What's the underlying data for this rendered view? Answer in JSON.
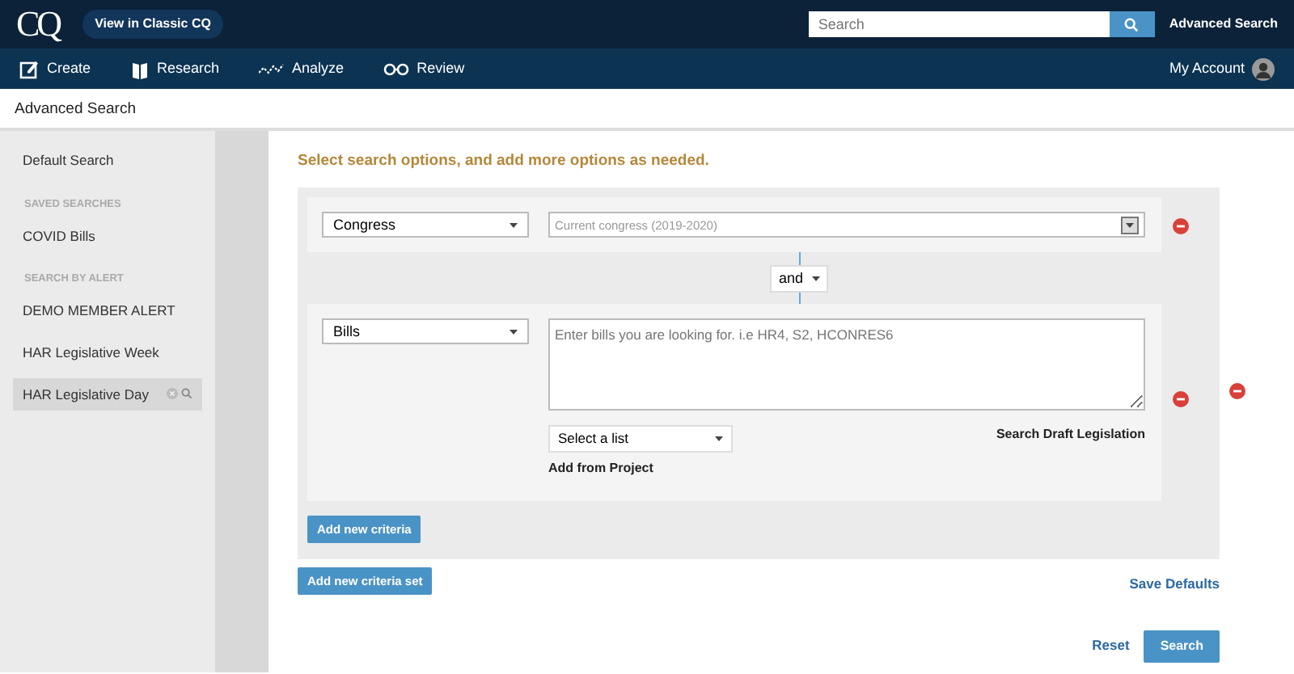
{
  "header": {
    "logo": "CQ",
    "classic_button": "View in Classic CQ",
    "search": {
      "placeholder": "Search"
    },
    "advanced_link": "Advanced Search"
  },
  "nav": {
    "items": [
      {
        "label": "Create"
      },
      {
        "label": "Research"
      },
      {
        "label": "Analyze"
      },
      {
        "label": "Review"
      }
    ],
    "account": "My Account"
  },
  "page_title": "Advanced Search",
  "sidebar": {
    "items": [
      {
        "kind": "item",
        "label": "Default Search",
        "selected": false
      },
      {
        "kind": "heading",
        "label": "SAVED SEARCHES"
      },
      {
        "kind": "item",
        "label": "COVID Bills",
        "selected": false
      },
      {
        "kind": "heading",
        "label": "SEARCH BY ALERT"
      },
      {
        "kind": "item",
        "label": "DEMO MEMBER ALERT",
        "selected": false
      },
      {
        "kind": "item",
        "label": "HAR Legislative Week",
        "selected": false
      },
      {
        "kind": "item",
        "label": "HAR Legislative Day",
        "selected": true
      }
    ]
  },
  "instruction": "Select search options, and add more options as needed.",
  "criteria_set": {
    "criteria": [
      {
        "kind": "dropdown",
        "field": "Congress",
        "value": "Current congress (2019-2020)"
      },
      {
        "kind": "bills",
        "field": "Bills",
        "placeholder": "Enter bills you are looking for. i.e HR4, S2, HCONRES6",
        "list_placeholder": "Select a list",
        "project_link": "Add from Project",
        "draft_link": "Search Draft Legislation"
      }
    ],
    "connector": "and",
    "add_button": "Add new criteria"
  },
  "add_set_button": "Add new criteria set",
  "save_defaults": "Save Defaults",
  "reset": "Reset",
  "search_button": "Search"
}
